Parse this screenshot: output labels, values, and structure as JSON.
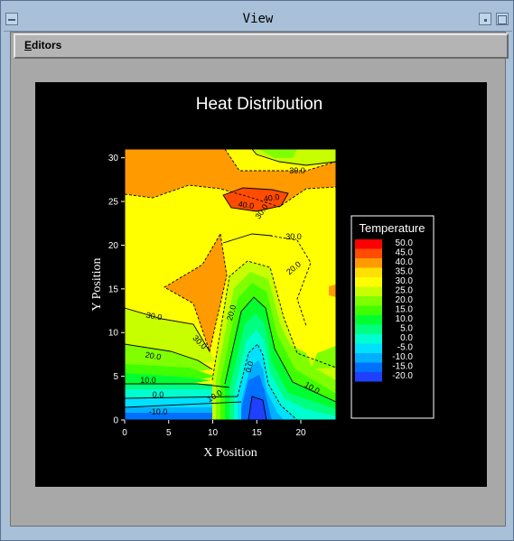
{
  "window": {
    "title": "View"
  },
  "menubar": {
    "editors_first": "E",
    "editors_rest": "ditors"
  },
  "chart_data": {
    "type": "heatmap",
    "title": "Heat Distribution",
    "xlabel": "X Position",
    "ylabel": "Y Position",
    "xlim": [
      0,
      24
    ],
    "ylim": [
      0,
      31
    ],
    "x_ticks": [
      "0",
      "5",
      "10",
      "15",
      "20"
    ],
    "y_ticks": [
      "0",
      "5",
      "10",
      "15",
      "20",
      "25",
      "30"
    ],
    "legend_title": "Temperature",
    "legend_levels": [
      "50.0",
      "45.0",
      "40.0",
      "35.0",
      "30.0",
      "25.0",
      "20.0",
      "15.0",
      "10.0",
      "5.0",
      "0.0",
      "-5.0",
      "-10.0",
      "-15.0",
      "-20.0"
    ],
    "legend_colors": [
      "#ff0000",
      "#ff4c00",
      "#ff9a00",
      "#ffe000",
      "#ffff00",
      "#c8ff00",
      "#80ff00",
      "#40ff00",
      "#00ff30",
      "#00ff80",
      "#00ffd0",
      "#00e0ff",
      "#00b0ff",
      "#0070ff",
      "#2040ff"
    ],
    "contour_labels": [
      "40.0",
      "40.0",
      "30.0",
      "30.0",
      "30.0",
      "30.0",
      "30.0",
      "20.0",
      "20.0",
      "20.0",
      "10.0",
      "10.0",
      "10.0",
      "0.0",
      "0.0",
      "-10.0"
    ]
  }
}
